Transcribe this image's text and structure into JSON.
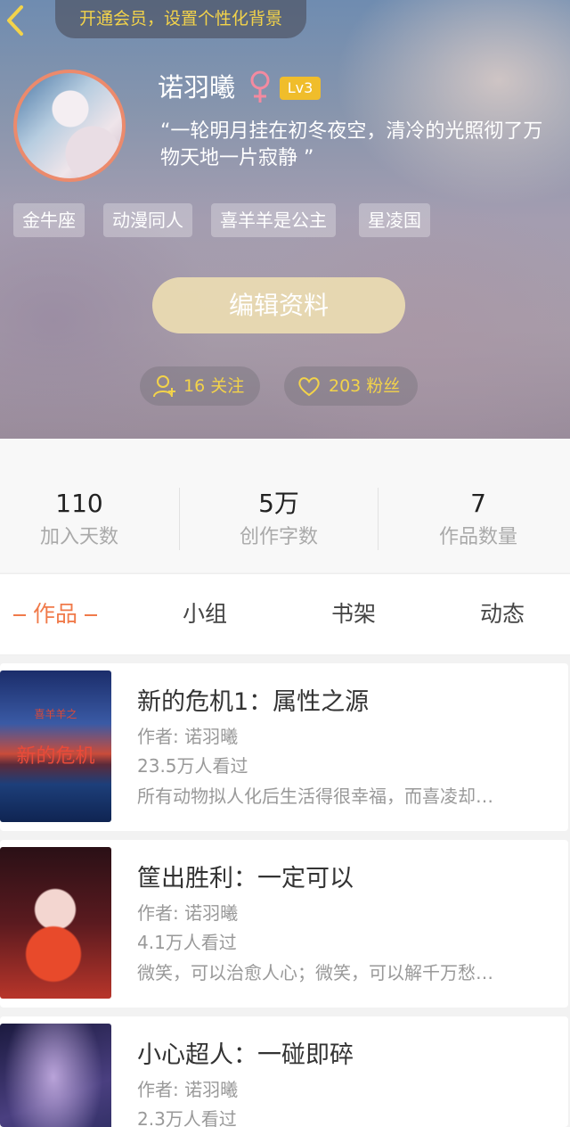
{
  "header": {
    "vip_banner": "开通会员，设置个性化背景",
    "username": "诺羽曦",
    "gender_symbol": "♀",
    "level": "Lv3",
    "signature": "“一轮明月挂在初冬夜空，清冷的光照彻了万物天地一片寂静 ”",
    "tags": [
      "金牛座",
      "动漫同人",
      "喜羊羊是公主",
      "星凌国"
    ],
    "edit_button": "编辑资料",
    "follow_label": "16 关注",
    "fans_label": "203 粉丝",
    "colors": {
      "accent_yellow": "#f3d34a",
      "avatar_border": "#ec8a6c",
      "level_badge": "#f0bd2b"
    }
  },
  "stats": [
    {
      "value": "110",
      "label": "加入天数"
    },
    {
      "value": "5万",
      "label": "创作字数"
    },
    {
      "value": "7",
      "label": "作品数量"
    }
  ],
  "tabs": [
    {
      "label": "作品",
      "active": true
    },
    {
      "label": "小组",
      "active": false
    },
    {
      "label": "书架",
      "active": false
    },
    {
      "label": "动态",
      "active": false
    }
  ],
  "works": [
    {
      "title": "新的危机1：属性之源",
      "author": "作者: 诺羽曦",
      "views": "23.5万人看过",
      "description": "所有动物拟人化后生活得很幸福，而喜凌却…",
      "cover_text": "新的危机",
      "cover_subtext": "喜羊羊之"
    },
    {
      "title": "筐出胜利：一定可以",
      "author": "作者: 诺羽曦",
      "views": "4.1万人看过",
      "description": "微笑，可以治愈人心；微笑，可以解千万愁…"
    },
    {
      "title": "小心超人：一碰即碎",
      "author": "作者: 诺羽曦",
      "views": "2.3万人看过",
      "description": ""
    }
  ]
}
